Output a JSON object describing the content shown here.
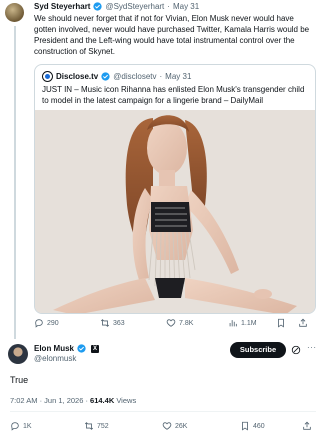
{
  "tweet1": {
    "author_name": "Syd Steyerhart",
    "handle": "@SydSteyerhart",
    "separator": "·",
    "date": "May 31",
    "text": "We should never forget that if not for Vivian, Elon Musk never would have gotten involved, never would have purchased Twitter, Kamala Harris would be President and the Left-wing would have total instrumental control over the construction of Skynet.",
    "quote": {
      "author_name": "Disclose.tv",
      "handle": "@disclosetv",
      "separator": "·",
      "date": "May 31",
      "text": "JUST IN – Music icon Rihanna has enlisted Elon Musk's transgender child to model in the latest campaign for a lingerie brand – DailyMail"
    },
    "actions": {
      "replies": "290",
      "reposts": "363",
      "likes": "7.8K",
      "views": "1.1M"
    }
  },
  "tweet2": {
    "author_name": "Elon Musk",
    "affiliate_badge": "X",
    "handle": "@elonmusk",
    "subscribe_label": "Subscribe",
    "more_label": "···",
    "text": "True",
    "time": "7:02 AM · Jun 1, 2026 · ",
    "views_count": "614.4K",
    "views_label": " Views",
    "actions": {
      "replies": "1K",
      "reposts": "752",
      "likes": "26K",
      "bookmarks": "460"
    }
  },
  "icons": {
    "verified": "verified-badge-icon",
    "reply": "reply-icon",
    "repost": "repost-icon",
    "like": "heart-icon",
    "views": "views-icon",
    "bookmark": "bookmark-icon",
    "share": "share-icon",
    "grok": "grok-icon"
  },
  "colors": {
    "verified_blue": "#1d9bf0",
    "text_primary": "#0f1419",
    "text_muted": "#536471",
    "border": "#cfd9de"
  }
}
